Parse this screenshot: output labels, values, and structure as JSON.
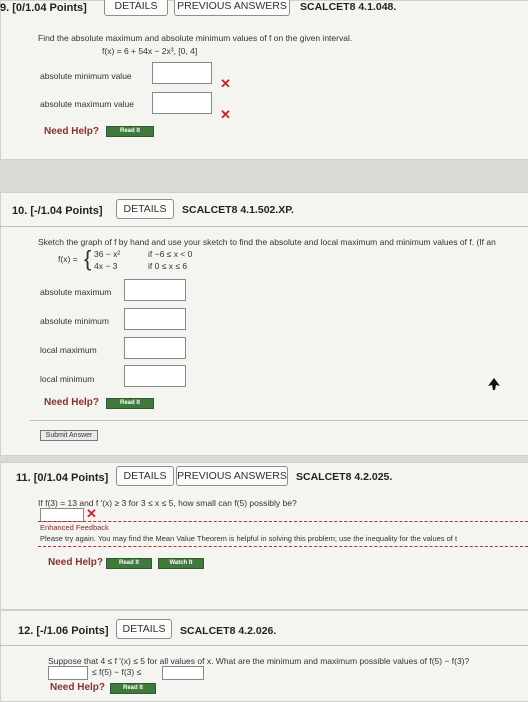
{
  "q9": {
    "number": "9.",
    "points": "[0/1.04 Points]",
    "details": "DETAILS",
    "previous": "PREVIOUS ANSWERS",
    "code": "SCALCET8 4.1.048.",
    "prompt": "Find the absolute maximum and absolute minimum values of f on the given interval.",
    "function": "f(x) = 6 + 54x − 2x³,    [0, 4]",
    "label_min": "absolute minimum value",
    "label_max": "absolute maximum value",
    "need_help": "Need Help?",
    "read_it": "Read It"
  },
  "q10": {
    "number": "10.",
    "points": "[-/1.04 Points]",
    "details": "DETAILS",
    "code": "SCALCET8 4.1.502.XP.",
    "prompt": "Sketch the graph of f by hand and use your sketch to find the absolute and local maximum and minimum values of f. (If an",
    "f_label": "f(x) =",
    "piece1": "36 − x²",
    "piece1_cond": "if −6 ≤ x < 0",
    "piece2": "4x − 3",
    "piece2_cond": "if 0 ≤ x ≤ 6",
    "labels": [
      "absolute maximum",
      "absolute minimum",
      "local maximum",
      "local minimum"
    ],
    "need_help": "Need Help?",
    "read_it": "Read It",
    "submit": "Submit Answer"
  },
  "q11": {
    "number": "11.",
    "points": "[0/1.04 Points]",
    "details": "DETAILS",
    "previous": "PREVIOUS ANSWERS",
    "code": "SCALCET8 4.2.025.",
    "prompt": "If f(3) = 13 and f '(x) ≥ 3 for 3 ≤ x ≤ 5, how small can f(5) possibly be?",
    "feedback_title": "Enhanced Feedback",
    "feedback_text": "Please try again. You may find the Mean Value Theorem is helpful in solving this problem; use the inequality for the values of t",
    "need_help": "Need Help?",
    "read_it": "Read It",
    "watch_it": "Watch It"
  },
  "q12": {
    "number": "12.",
    "points": "[-/1.06 Points]",
    "details": "DETAILS",
    "code": "SCALCET8 4.2.026.",
    "prompt": "Suppose that 4 ≤ f '(x) ≤ 5 for all values of x. What are the minimum and maximum possible values of f(5) − f(3)?",
    "ineq": "≤ f(5) − f(3) ≤",
    "need_help": "Need Help?",
    "read_it": "Read It"
  }
}
